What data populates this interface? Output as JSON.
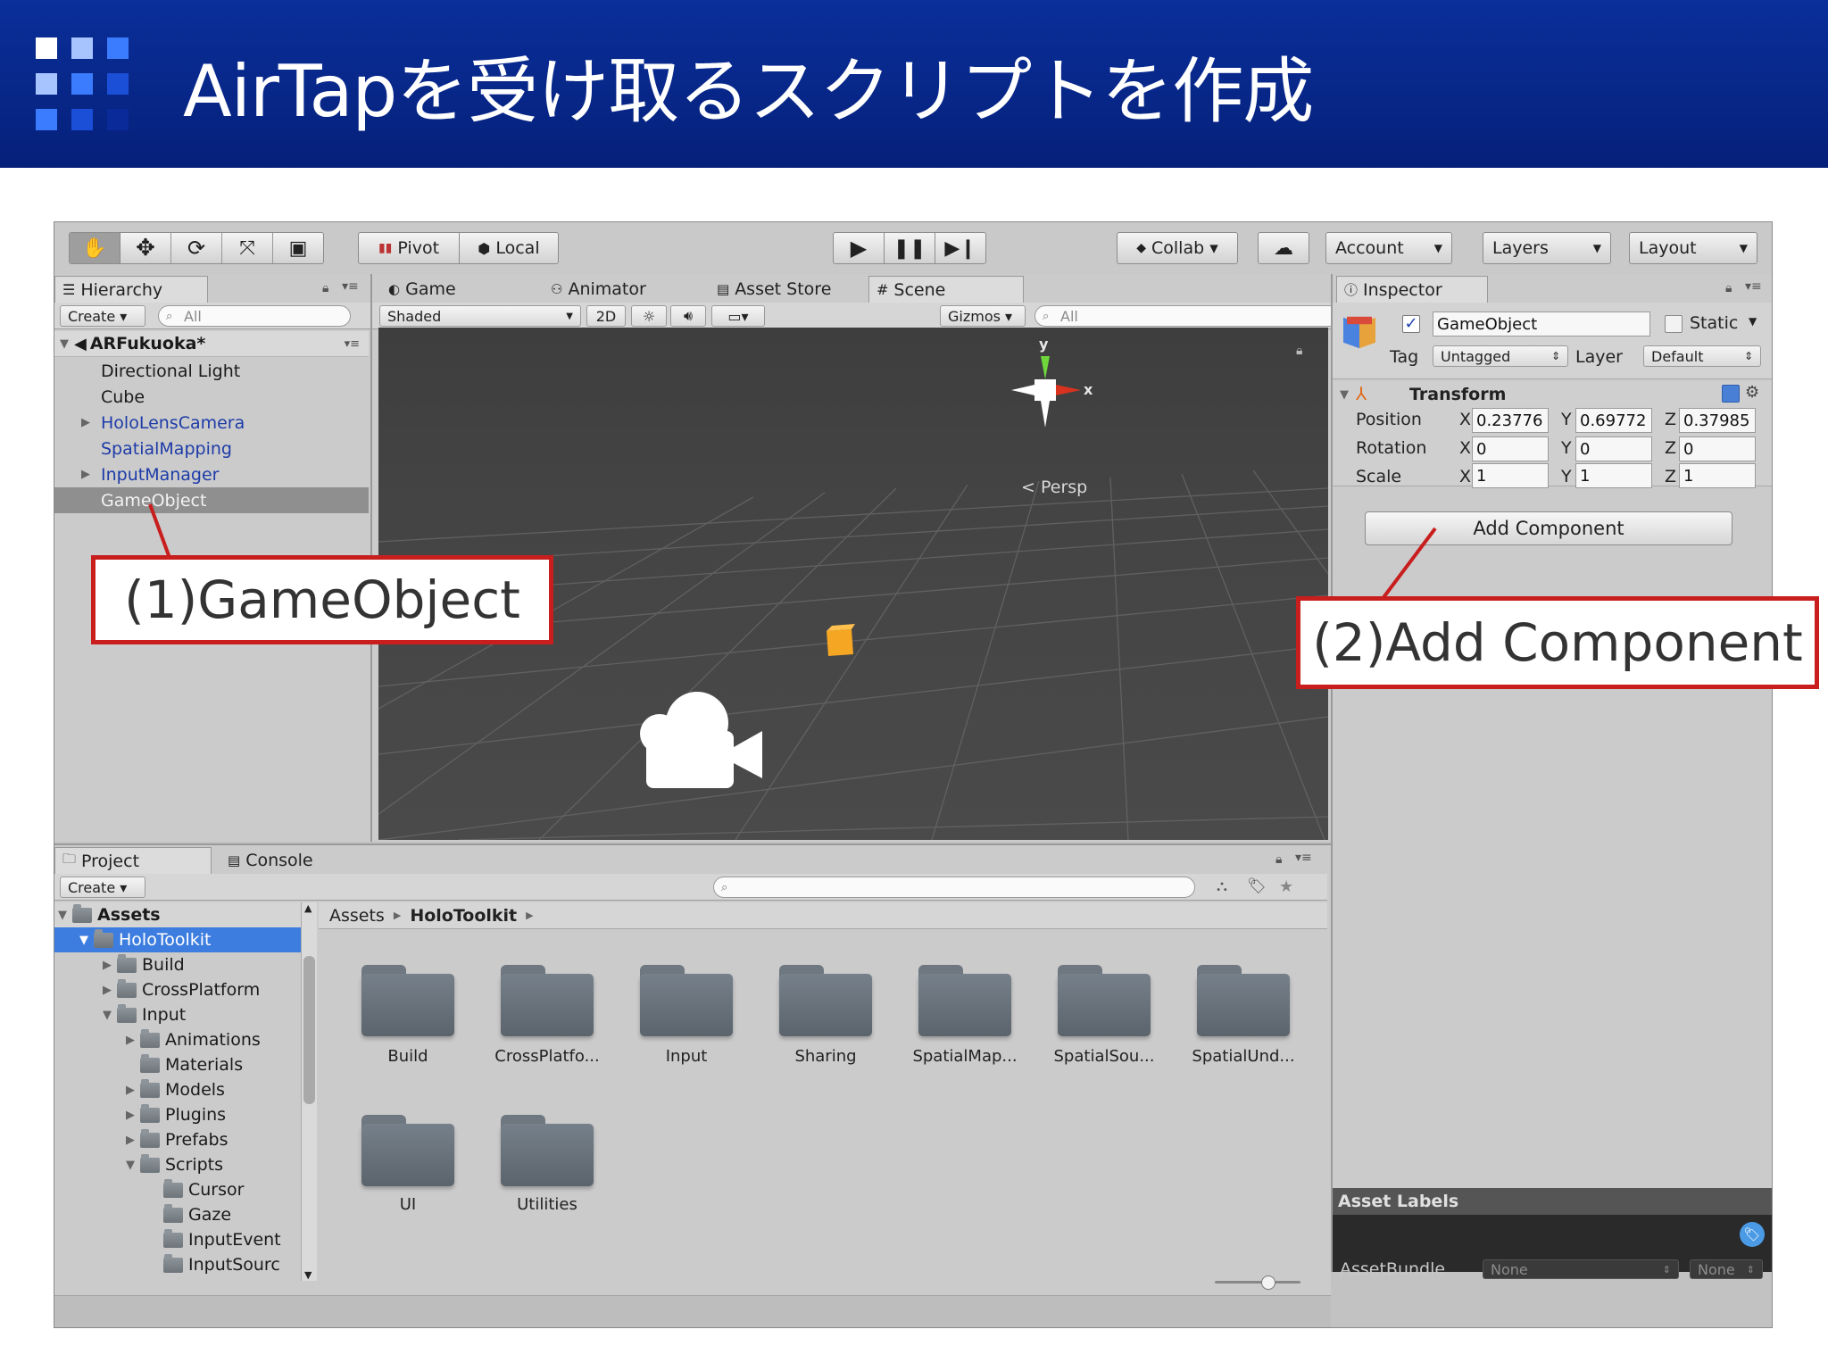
{
  "slide": {
    "title": "AirTapを受け取るスクリプトを作成"
  },
  "toolbar": {
    "pivot": "Pivot",
    "local": "Local",
    "collab": "Collab ▾",
    "account": "Account",
    "layers": "Layers",
    "layout": "Layout"
  },
  "hierarchy": {
    "tab": "Hierarchy",
    "create": "Create ▾",
    "search_placeholder": "All",
    "scene_name": "ARFukuoka*",
    "items": [
      {
        "label": "Directional Light"
      },
      {
        "label": "Cube"
      },
      {
        "label": "HoloLensCamera"
      },
      {
        "label": "SpatialMapping"
      },
      {
        "label": "InputManager"
      },
      {
        "label": "GameObject"
      }
    ]
  },
  "views": {
    "tab_game": "Game",
    "tab_animator": "Animator",
    "tab_asset_store": "Asset Store",
    "tab_scene": "Scene",
    "shaded": "Shaded",
    "mode_2d": "2D",
    "gizmos": "Gizmos ▾",
    "search_placeholder": "All",
    "persp": "Persp",
    "axis_y": "y",
    "axis_x": "x"
  },
  "inspector": {
    "tab": "Inspector",
    "object_name": "GameObject",
    "static_label": "Static",
    "tag_label": "Tag",
    "tag_value": "Untagged",
    "layer_label": "Layer",
    "layer_value": "Default",
    "transform_title": "Transform",
    "position_label": "Position",
    "rotation_label": "Rotation",
    "scale_label": "Scale",
    "axis_x": "X",
    "axis_y": "Y",
    "axis_z": "Z",
    "position": {
      "x": "0.23776",
      "y": "0.69772",
      "z": "0.37985"
    },
    "rotation": {
      "x": "0",
      "y": "0",
      "z": "0"
    },
    "scale": {
      "x": "1",
      "y": "1",
      "z": "1"
    },
    "add_component": "Add Component",
    "asset_labels": "Asset Labels",
    "asset_bundle_label": "AssetBundle",
    "asset_bundle_value": "None",
    "asset_bundle_variant": "None"
  },
  "project": {
    "tab_project": "Project",
    "tab_console": "Console",
    "create": "Create ▾",
    "tree": [
      {
        "label": "Assets"
      },
      {
        "label": "HoloToolkit"
      },
      {
        "label": "Build"
      },
      {
        "label": "CrossPlatform"
      },
      {
        "label": "Input"
      },
      {
        "label": "Animations"
      },
      {
        "label": "Materials"
      },
      {
        "label": "Models"
      },
      {
        "label": "Plugins"
      },
      {
        "label": "Prefabs"
      },
      {
        "label": "Scripts"
      },
      {
        "label": "Cursor"
      },
      {
        "label": "Gaze"
      },
      {
        "label": "InputEvent"
      },
      {
        "label": "InputSourc"
      }
    ],
    "breadcrumb": {
      "root": "Assets",
      "current": "HoloToolkit"
    },
    "folders": [
      {
        "label": "Build"
      },
      {
        "label": "CrossPlatfo..."
      },
      {
        "label": "Input"
      },
      {
        "label": "Sharing"
      },
      {
        "label": "SpatialMap..."
      },
      {
        "label": "SpatialSou..."
      },
      {
        "label": "SpatialUnd..."
      },
      {
        "label": "UI"
      },
      {
        "label": "Utilities"
      }
    ]
  },
  "callouts": {
    "gameobject": "(1)GameObject",
    "add_component": "(2)Add Component"
  },
  "colors": {
    "header_blue": "#05207a",
    "callout_red": "#c81e1e",
    "selection_blue": "#3d7de0",
    "editor_gray": "#c2c2c2",
    "scene_dark": "#444444",
    "hierarchy_link_blue": "#1d3ba8"
  }
}
